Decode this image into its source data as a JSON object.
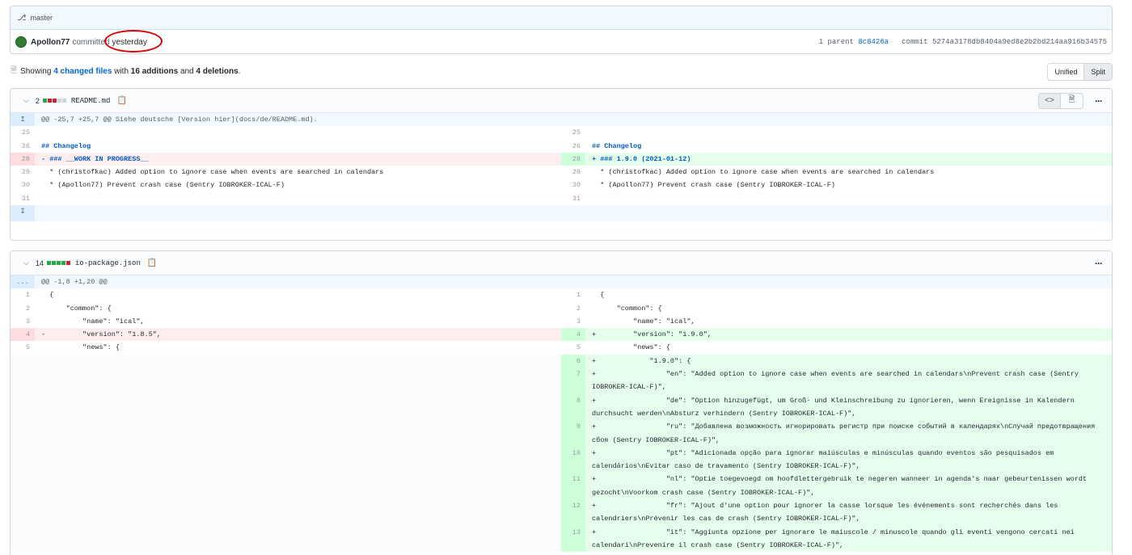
{
  "commit": {
    "branch": "master",
    "author": "Apollon77",
    "action": "committed",
    "time": "yesterday",
    "parent_label": "1 parent",
    "parent_sha": "8c8426a",
    "commit_label": "commit",
    "commit_sha": "5274a3178db8404a9ed8e2b2bd214aa916b34575"
  },
  "summary": {
    "showing": "Showing",
    "files_changed": "4 changed files",
    "with": "with",
    "additions": "16 additions",
    "and": "and",
    "deletions": "4 deletions",
    "period": "."
  },
  "view_toggle": {
    "unified": "Unified",
    "split": "Split"
  },
  "files": [
    {
      "count": "2",
      "name": "README.md",
      "hunk": "@@ -25,7 +25,7 @@ Siehe deutsche [Version hier](docs/de/README.md).",
      "left": [
        {
          "n": "25",
          "t": ""
        },
        {
          "n": "26",
          "t": "## Changelog"
        },
        {
          "n": "28",
          "t": "- ### __WORK IN PROGRESS__"
        },
        {
          "n": "29",
          "t": "  * (christofkac) Added option to ignore case when events are searched in calendars"
        },
        {
          "n": "30",
          "t": "  * (Apollon77) Prevent crash case (Sentry IOBROKER-ICAL-F)"
        },
        {
          "n": "31",
          "t": ""
        }
      ],
      "right": [
        {
          "n": "25",
          "t": ""
        },
        {
          "n": "26",
          "t": "## Changelog"
        },
        {
          "n": "28",
          "t": "+ ### 1.9.0 (2021-01-12)"
        },
        {
          "n": "29",
          "t": "  * (christofkac) Added option to ignore case when events are searched in calendars"
        },
        {
          "n": "30",
          "t": "  * (Apollon77) Prevent crash case (Sentry IOBROKER-ICAL-F)"
        },
        {
          "n": "31",
          "t": ""
        }
      ]
    },
    {
      "count": "14",
      "name": "io-package.json",
      "hunk": "@@ -1,8 +1,20 @@",
      "hunk_gutter": "...",
      "left": [
        {
          "n": "1",
          "t": "  {"
        },
        {
          "n": "2",
          "t": "      \"common\": {"
        },
        {
          "n": "3",
          "t": "          \"name\": \"ical\","
        },
        {
          "n": "4",
          "t": "-         \"version\": \"1.8.5\","
        },
        {
          "n": "5",
          "t": "          \"news\": {"
        }
      ],
      "right": [
        {
          "n": "1",
          "t": "  {"
        },
        {
          "n": "2",
          "t": "      \"common\": {"
        },
        {
          "n": "3",
          "t": "          \"name\": \"ical\","
        },
        {
          "n": "4",
          "t": "+         \"version\": \"1.9.0\","
        },
        {
          "n": "5",
          "t": "          \"news\": {"
        },
        {
          "n": "6",
          "t": "+             \"1.9.0\": {"
        },
        {
          "n": "7",
          "t": "+                 \"en\": \"Added option to ignore case when events are searched in calendars\\nPrevent crash case (Sentry IOBROKER-ICAL-F)\","
        },
        {
          "n": "8",
          "t": "+                 \"de\": \"Option hinzugefügt, um Groß- und Kleinschreibung zu ignorieren, wenn Ereignisse in Kalendern durchsucht werden\\nAbsturz verhindern (Sentry IOBROKER-ICAL-F)\","
        },
        {
          "n": "9",
          "t": "+                 \"ru\": \"Добавлена возможность игнорировать регистр при поиске событий в календарях\\nСлучай предотвращения сбоя (Sentry IOBROKER-ICAL-F)\","
        },
        {
          "n": "10",
          "t": "+                 \"pt\": \"Adicionada opção para ignorar maiúsculas e minúsculas quando eventos são pesquisados em calendários\\nEvitar caso de travamento (Sentry IOBROKER-ICAL-F)\","
        },
        {
          "n": "11",
          "t": "+                 \"nl\": \"Optie toegevoegd om hoofdlettergebruik te negeren wanneer in agenda's naar gebeurtenissen wordt gezocht\\nVoorkom crash case (Sentry IOBROKER-ICAL-F)\","
        },
        {
          "n": "12",
          "t": "+                 \"fr\": \"Ajout d'une option pour ignorer la casse lorsque les événements sont recherchés dans les calendriers\\nPrévenir les cas de crash (Sentry IOBROKER-ICAL-F)\","
        },
        {
          "n": "13",
          "t": "+                 \"it\": \"Aggiunta opzione per ignorare le maiuscole / minuscole quando gli eventi vengono cercati nei calendari\\nPrevenire il crash case (Sentry IOBROKER-ICAL-F)\","
        }
      ]
    }
  ]
}
